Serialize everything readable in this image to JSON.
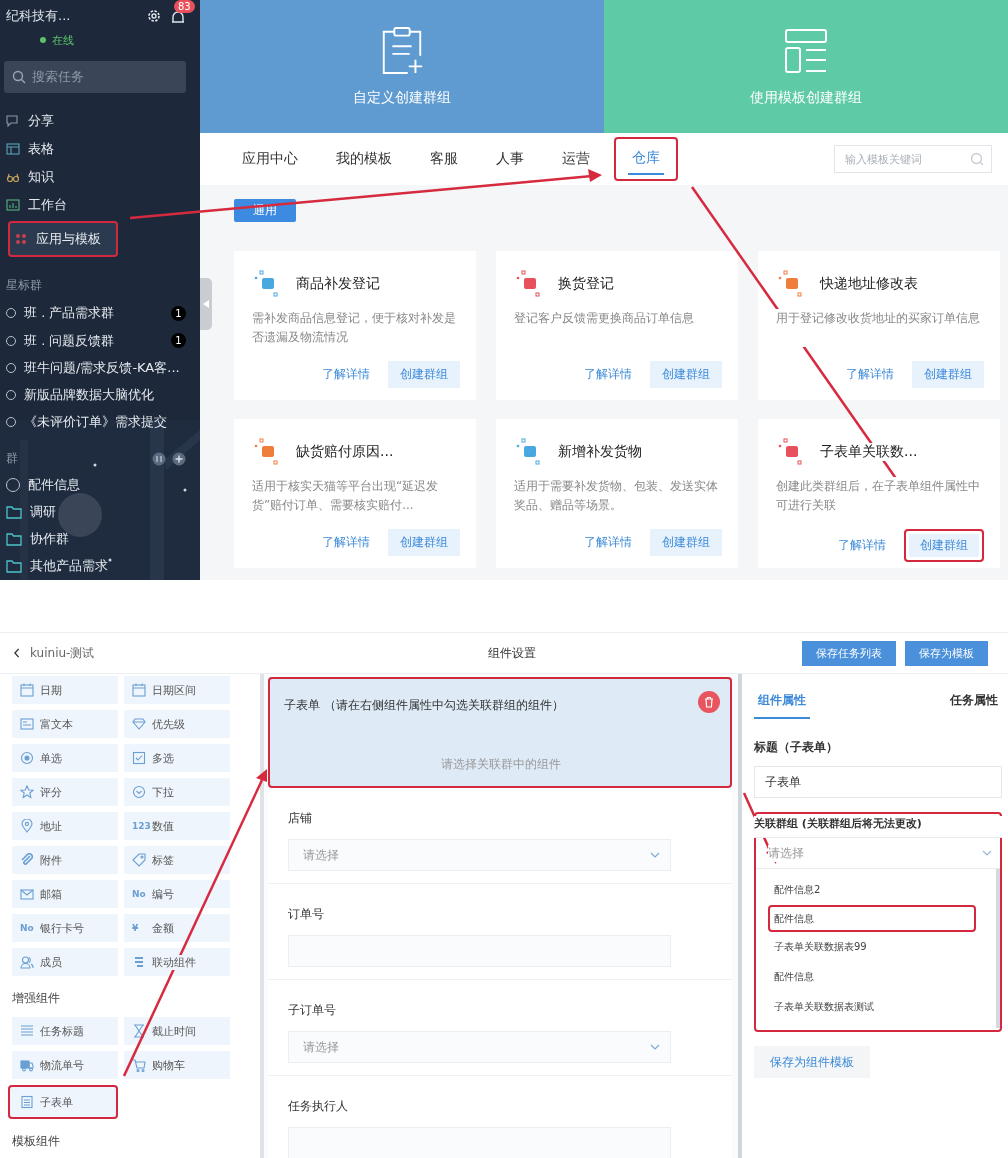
{
  "top": {
    "sidebar": {
      "company": "纪科技有...",
      "unread": "83",
      "status": "在线",
      "search_placeholder": "搜索任务",
      "nav": [
        {
          "label": "分享",
          "selected": false,
          "highlighted": false
        },
        {
          "label": "表格",
          "selected": false,
          "highlighted": false
        },
        {
          "label": "知识",
          "selected": false,
          "highlighted": false
        },
        {
          "label": "工作台",
          "selected": false,
          "highlighted": false
        },
        {
          "label": "应用与模板",
          "selected": true,
          "highlighted": true
        }
      ],
      "starred_title": "星标群",
      "starred": [
        {
          "label": "班 . 产品需求群",
          "badge": "1"
        },
        {
          "label": "班 . 问题反馈群",
          "badge": "1"
        },
        {
          "label": "班牛问题/需求反馈-KA客..."
        },
        {
          "label": "新版品牌数据大脑优化"
        },
        {
          "label": "《未评价订单》需求提交"
        }
      ],
      "groups_title": "群",
      "groups": [
        {
          "label": "配件信息",
          "kind": "group"
        },
        {
          "label": "调研",
          "kind": "folder"
        },
        {
          "label": "协作群",
          "kind": "folder"
        },
        {
          "label": "其他产品需求",
          "kind": "folder"
        }
      ]
    },
    "hero": [
      {
        "label": "自定义创建群组",
        "color": "#5f9bd0"
      },
      {
        "label": "使用模板创建群组",
        "color": "#5ecba6"
      }
    ],
    "tabs": [
      {
        "label": "应用中心",
        "selected": false,
        "highlighted": false
      },
      {
        "label": "我的模板",
        "selected": false,
        "highlighted": false
      },
      {
        "label": "客服",
        "selected": false,
        "highlighted": false
      },
      {
        "label": "人事",
        "selected": false,
        "highlighted": false
      },
      {
        "label": "运营",
        "selected": false,
        "highlighted": false
      },
      {
        "label": "仓库",
        "selected": true,
        "highlighted": true
      }
    ],
    "search_placeholder": "输入模板关键词",
    "filter_button": "通用",
    "cards": [
      {
        "title": "商品补发登记",
        "desc": "需补发商品信息登记，便于核对补发是否遗漏及物流情况",
        "link": "了解详情",
        "button": "创建群组",
        "color": "#4aa8e0",
        "button_highlighted": false
      },
      {
        "title": "换货登记",
        "desc": "登记客户反馈需更换商品订单信息",
        "link": "了解详情",
        "button": "创建群组",
        "color": "#e8505b",
        "button_highlighted": false
      },
      {
        "title": "快递地址修改表",
        "desc": "用于登记修改收货地址的买家订单信息",
        "link": "了解详情",
        "button": "创建群组",
        "color": "#ef7d3c",
        "button_highlighted": false
      },
      {
        "title": "缺货赔付原因...",
        "desc": "适用于核实天猫等平台出现“延迟发货”赔付订单、需要核实赔付...",
        "link": "了解详情",
        "button": "创建群组",
        "color": "#ef7d3c",
        "button_highlighted": false
      },
      {
        "title": "新增补发货物",
        "desc": "适用于需要补发货物、包装、发送实体奖品、赠品等场景。",
        "link": "了解详情",
        "button": "创建群组",
        "color": "#4aa8e0",
        "button_highlighted": false
      },
      {
        "title": "子表单关联数...",
        "desc": "创建此类群组后，在子表单组件属性中可进行关联",
        "link": "了解详情",
        "button": "创建群组",
        "color": "#e8505b",
        "button_highlighted": true
      }
    ]
  },
  "bottom": {
    "back": "kuiniu-测试",
    "title": "组件设置",
    "actions": [
      "保存任务列表",
      "保存为模板"
    ],
    "palette": [
      {
        "items": [
          {
            "label": "日期"
          },
          {
            "label": "日期区间"
          },
          {
            "label": "富文本"
          },
          {
            "label": "优先级"
          },
          {
            "label": "单选"
          },
          {
            "label": "多选"
          },
          {
            "label": "评分"
          },
          {
            "label": "下拉"
          },
          {
            "label": "地址"
          },
          {
            "label": "数值",
            "glyph": "123"
          },
          {
            "label": "附件"
          },
          {
            "label": "标签"
          },
          {
            "label": "邮箱"
          },
          {
            "label": "编号",
            "glyph": "No"
          },
          {
            "label": "银行卡号",
            "glyph": "No"
          },
          {
            "label": "金额",
            "glyph": "¥"
          },
          {
            "label": "成员"
          },
          {
            "label": "联动组件"
          }
        ]
      },
      {
        "title": "增强组件",
        "items": [
          {
            "label": "任务标题"
          },
          {
            "label": "截止时间"
          },
          {
            "label": "物流单号"
          },
          {
            "label": "购物车"
          },
          {
            "label": "子表单",
            "highlighted": true
          }
        ]
      },
      {
        "title": "模板组件"
      }
    ],
    "form": [
      {
        "kind": "subform",
        "label": "子表单",
        "hint": "（请在右侧组件属性中勾选关联群组的组件）",
        "placeholder": "请选择关联群中的组件",
        "highlighted": true
      },
      {
        "kind": "select",
        "label": "店铺",
        "placeholder": "请选择"
      },
      {
        "kind": "input",
        "label": "订单号"
      },
      {
        "kind": "select",
        "label": "子订单号",
        "placeholder": "请选择"
      },
      {
        "kind": "input",
        "label": "任务执行人"
      }
    ],
    "props": {
      "tabs": [
        {
          "label": "组件属性",
          "selected": true
        },
        {
          "label": "任务属性",
          "selected": false
        }
      ],
      "title_label": "标题（子表单）",
      "title_value": "子表单",
      "link_label": "关联群组 (关联群组后将无法更改)",
      "link_placeholder": "请选择",
      "link_highlighted": true,
      "options": [
        {
          "label": "配件信息2",
          "highlighted": false
        },
        {
          "label": "配件信息",
          "highlighted": true
        },
        {
          "label": "子表单关联数据表99",
          "highlighted": false
        },
        {
          "label": "配件信息",
          "highlighted": false
        },
        {
          "label": "子表单关联数据表测试",
          "highlighted": false
        }
      ],
      "save_template": "保存为组件模板"
    }
  }
}
